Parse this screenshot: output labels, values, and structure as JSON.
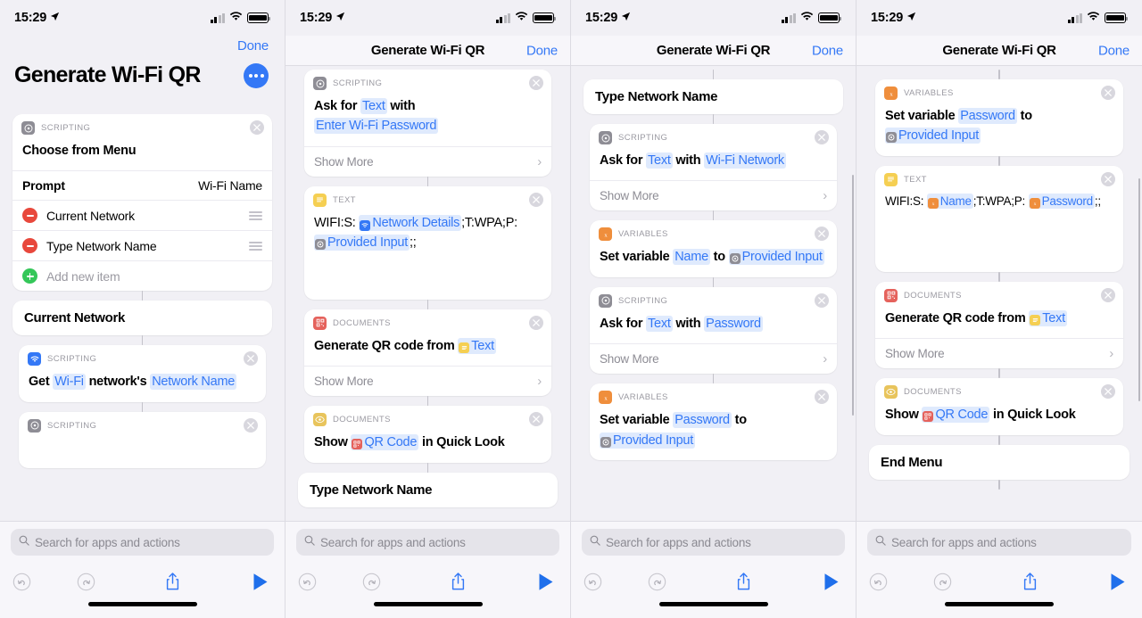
{
  "status_bar": {
    "time": "15:29",
    "location_icon": "location-arrow-icon",
    "wifi_icon": "wifi-icon",
    "battery_icon": "battery-full-icon"
  },
  "app": {
    "title": "Generate Wi-Fi QR",
    "done_label": "Done",
    "more_label": "more-options"
  },
  "search": {
    "placeholder": "Search for apps and actions",
    "icon": "search-icon"
  },
  "toolbar": {
    "undo": "undo-icon",
    "redo": "redo-icon",
    "share": "share-icon",
    "play": "play-icon"
  },
  "labels": {
    "show_more": "Show More",
    "scripting": "SCRIPTING",
    "text": "TEXT",
    "documents": "DOCUMENTS",
    "variables": "VARIABLES"
  },
  "colors": {
    "accent": "#3478f6",
    "token_bg": "#dfeafd",
    "scripting_gray": "#8e8d95",
    "scripting_blue": "#3478f6",
    "text_yellow": "#f5cf52",
    "documents_red": "#e5625c",
    "documents_yellow": "#e8c45c",
    "variables_orange": "#ef8e3c",
    "minus_red": "#e8483c",
    "plus_green": "#34c759"
  },
  "panel1": {
    "choose_menu": {
      "category": "SCRIPTING",
      "title": "Choose from Menu",
      "prompt_label": "Prompt",
      "prompt_value": "Wi-Fi Name",
      "items": [
        "Current Network",
        "Type Network Name"
      ],
      "add_new": "Add new item"
    },
    "menu_case_label": "Current Network",
    "get_wifi": {
      "category": "SCRIPTING",
      "t1": "Get",
      "tok1": "Wi-Fi",
      "t2": "network's",
      "tok2": "Network Name"
    }
  },
  "panel2": {
    "ask_password": {
      "category": "SCRIPTING",
      "t1": "Ask for",
      "tok1": "Text",
      "t2": "with",
      "tok2": "Enter Wi-Fi Password"
    },
    "text_block": {
      "category": "TEXT",
      "t1": "WIFI:S:",
      "tok1": "Network Details",
      "t2": ";T:WPA;P:",
      "tok2": "Provided Input",
      "t3": ";;"
    },
    "gen_qr": {
      "category": "DOCUMENTS",
      "t1": "Generate QR code from",
      "tok1": "Text"
    },
    "show_qr": {
      "category": "DOCUMENTS",
      "t1": "Show",
      "tok1": "QR Code",
      "t2": "in Quick Look"
    },
    "partial_label": "Type Network Name"
  },
  "panel3": {
    "menu_case_label": "Type Network Name",
    "ask_network": {
      "category": "SCRIPTING",
      "t1": "Ask for",
      "tok1": "Text",
      "t2": "with",
      "tok2": "Wi-Fi Network"
    },
    "set_name": {
      "category": "VARIABLES",
      "t1": "Set variable",
      "tok1": "Name",
      "t2": "to",
      "tok2": "Provided Input"
    },
    "ask_password": {
      "category": "SCRIPTING",
      "t1": "Ask for",
      "tok1": "Text",
      "t2": "with",
      "tok2": "Password"
    },
    "set_password": {
      "category": "VARIABLES",
      "t1": "Set variable",
      "tok1": "Password",
      "t2": "to",
      "tok2": "Provided Input"
    }
  },
  "panel4": {
    "set_password": {
      "category": "VARIABLES",
      "t1": "Set variable",
      "tok1": "Password",
      "t2": "to",
      "tok2": "Provided Input"
    },
    "text_block": {
      "category": "TEXT",
      "t1": "WIFI:S:",
      "tok1": "Name",
      "t2": ";T:WPA;P:",
      "tok2": "Password",
      "t3": ";;"
    },
    "gen_qr": {
      "category": "DOCUMENTS",
      "t1": "Generate QR code from",
      "tok1": "Text"
    },
    "show_qr": {
      "category": "DOCUMENTS",
      "t1": "Show",
      "tok1": "QR Code",
      "t2": "in Quick Look"
    },
    "end_menu": "End Menu"
  }
}
